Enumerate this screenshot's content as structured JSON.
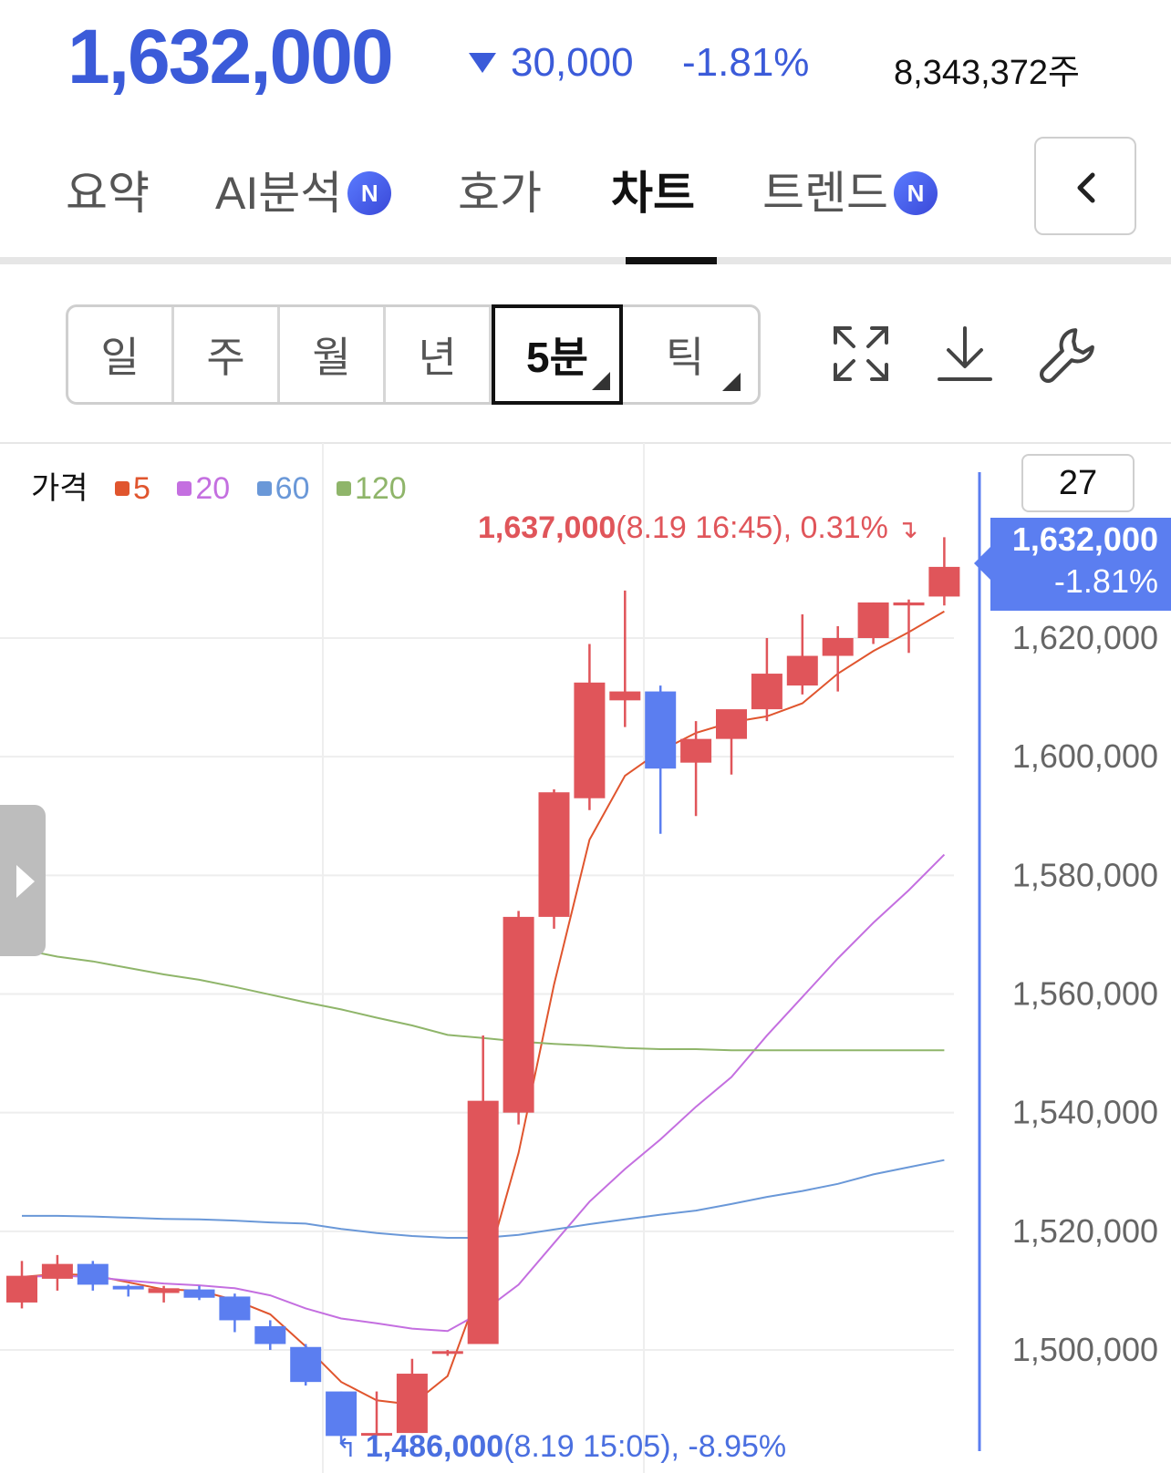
{
  "quote": {
    "price": "1,632,000",
    "change_abs": "30,000",
    "change_pct": "-1.81%",
    "volume": "8,343,372주",
    "color": "#3b5bd9"
  },
  "tabs": [
    {
      "label": "요약",
      "badge": ""
    },
    {
      "label": "AI분석",
      "badge": "N"
    },
    {
      "label": "호가",
      "badge": ""
    },
    {
      "label": "차트",
      "badge": "",
      "active": true
    },
    {
      "label": "트렌드",
      "badge": "N"
    }
  ],
  "back_button": {
    "icon": "chevron-left-icon"
  },
  "periods": [
    {
      "label": "일"
    },
    {
      "label": "주"
    },
    {
      "label": "월"
    },
    {
      "label": "년"
    },
    {
      "label": "5분",
      "active": true,
      "has_menu": true
    },
    {
      "label": "틱",
      "has_menu": true
    }
  ],
  "tools": [
    "expand-icon",
    "download-icon",
    "wrench-icon"
  ],
  "legend": {
    "label": "가격",
    "items": [
      {
        "name": "5",
        "color": "#e0552e"
      },
      {
        "name": "20",
        "color": "#c46fe0"
      },
      {
        "name": "60",
        "color": "#6a98d8"
      },
      {
        "name": "120",
        "color": "#8fb56a"
      }
    ]
  },
  "candle_count": "27",
  "current_tag": {
    "price": "1,632,000",
    "change": "-1.81%",
    "color": "#5b7ef0"
  },
  "high_annotation": {
    "price": "1,637,000",
    "detail": "(8.19 16:45), 0.31%",
    "color": "#e0555a"
  },
  "low_annotation": {
    "price": "1,486,000",
    "detail": "(8.19 15:05), -8.95%",
    "color": "#4a6fe0"
  },
  "chart_data": {
    "type": "candlestick",
    "y_ticks": [
      "1,620,000",
      "1,600,000",
      "1,580,000",
      "1,560,000",
      "1,540,000",
      "1,520,000",
      "1,500,000"
    ],
    "ylim": [
      1482500,
      1655000
    ],
    "up_color": "#e0555a",
    "down_color": "#5b7ef0",
    "candles": [
      {
        "o": 1508000,
        "h": 1515000,
        "l": 1507000,
        "c": 1512500
      },
      {
        "o": 1512000,
        "h": 1516000,
        "l": 1510000,
        "c": 1514500
      },
      {
        "o": 1514500,
        "h": 1515000,
        "l": 1510000,
        "c": 1511000
      },
      {
        "o": 1510800,
        "h": 1511000,
        "l": 1509000,
        "c": 1510200
      },
      {
        "o": 1509600,
        "h": 1510800,
        "l": 1508000,
        "c": 1510400
      },
      {
        "o": 1510200,
        "h": 1510800,
        "l": 1508400,
        "c": 1508800
      },
      {
        "o": 1509000,
        "h": 1509500,
        "l": 1503000,
        "c": 1505000
      },
      {
        "o": 1504000,
        "h": 1505000,
        "l": 1500000,
        "c": 1501000
      },
      {
        "o": 1500500,
        "h": 1501000,
        "l": 1494000,
        "c": 1494600
      },
      {
        "o": 1493000,
        "h": 1493000,
        "l": 1484500,
        "c": 1485500
      },
      {
        "o": 1486000,
        "h": 1493000,
        "l": 1485500,
        "c": 1486000
      },
      {
        "o": 1486000,
        "h": 1498500,
        "l": 1486000,
        "c": 1496000
      },
      {
        "o": 1499600,
        "h": 1500000,
        "l": 1499000,
        "c": 1499800
      },
      {
        "o": 1501000,
        "h": 1553000,
        "l": 1501000,
        "c": 1542000
      },
      {
        "o": 1540000,
        "h": 1574000,
        "l": 1538000,
        "c": 1573000
      },
      {
        "o": 1573000,
        "h": 1594500,
        "l": 1571000,
        "c": 1594000
      },
      {
        "o": 1593000,
        "h": 1619000,
        "l": 1591000,
        "c": 1612500
      },
      {
        "o": 1609500,
        "h": 1628000,
        "l": 1605000,
        "c": 1611000
      },
      {
        "o": 1611000,
        "h": 1612000,
        "l": 1587000,
        "c": 1598000
      },
      {
        "o": 1599000,
        "h": 1606000,
        "l": 1590000,
        "c": 1603000
      },
      {
        "o": 1603000,
        "h": 1607500,
        "l": 1597000,
        "c": 1608000
      },
      {
        "o": 1608000,
        "h": 1620000,
        "l": 1606000,
        "c": 1614000
      },
      {
        "o": 1612000,
        "h": 1624000,
        "l": 1610500,
        "c": 1617000
      },
      {
        "o": 1617000,
        "h": 1622000,
        "l": 1611000,
        "c": 1620000
      },
      {
        "o": 1620000,
        "h": 1626000,
        "l": 1619000,
        "c": 1626000
      },
      {
        "o": 1625500,
        "h": 1626500,
        "l": 1617500,
        "c": 1626000
      },
      {
        "o": 1627000,
        "h": 1637000,
        "l": 1625500,
        "c": 1632000
      }
    ],
    "series": [
      {
        "name": "5",
        "values": [
          1512300,
          1512800,
          1512600,
          1511400,
          1510200,
          1510000,
          1508400,
          1506000,
          1500600,
          1494600,
          1491500,
          1490800,
          1495600,
          1512000,
          1533200,
          1561600,
          1586000,
          1596800,
          1601000,
          1604000,
          1605800,
          1606800,
          1609000,
          1614000,
          1617800,
          1621000,
          1624500
        ]
      },
      {
        "name": "20",
        "values": [
          1512300,
          1512500,
          1512300,
          1511700,
          1511200,
          1510900,
          1510400,
          1509200,
          1507000,
          1505300,
          1504500,
          1503600,
          1503200,
          1506500,
          1511000,
          1518000,
          1525000,
          1530500,
          1535500,
          1541000,
          1546000,
          1553000,
          1559500,
          1566000,
          1572000,
          1577500,
          1583500
        ]
      },
      {
        "name": "60",
        "values": [
          1522600,
          1522600,
          1522500,
          1522300,
          1522100,
          1522000,
          1521800,
          1521500,
          1521300,
          1520400,
          1519700,
          1519200,
          1518900,
          1518900,
          1519400,
          1520300,
          1521200,
          1522000,
          1522800,
          1523500,
          1524600,
          1525800,
          1526800,
          1528000,
          1529600,
          1530800,
          1532000
        ]
      },
      {
        "name": "120",
        "values": [
          1567500,
          1566300,
          1565500,
          1564400,
          1563300,
          1562400,
          1561200,
          1559900,
          1558600,
          1557400,
          1556000,
          1554700,
          1553100,
          1552600,
          1552000,
          1551600,
          1551300,
          1550900,
          1550700,
          1550700,
          1550500,
          1550500,
          1550500,
          1550500,
          1550500,
          1550500,
          1550500
        ]
      }
    ]
  }
}
